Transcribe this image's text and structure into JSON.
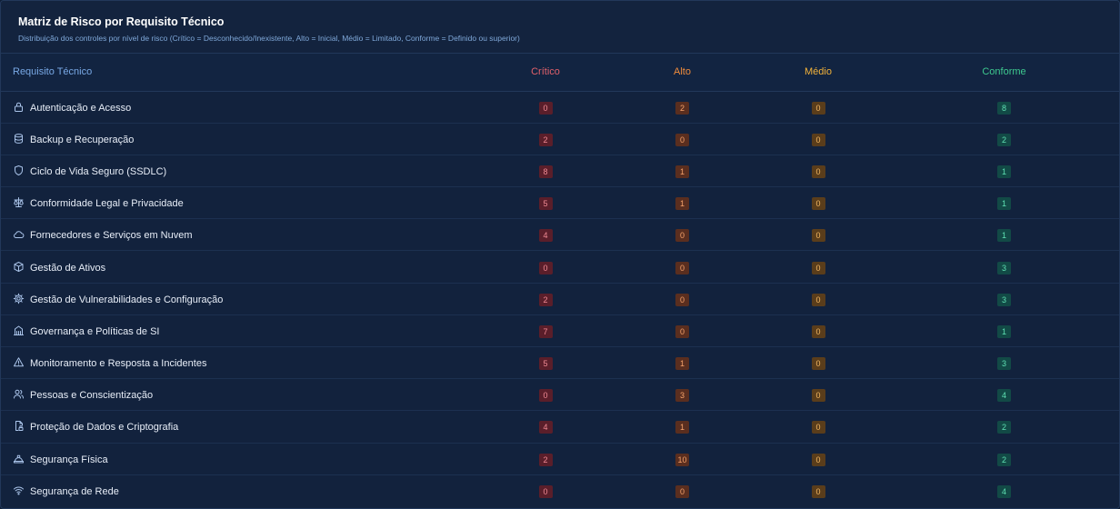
{
  "header": {
    "title": "Matriz de Risco por Requisito Técnico",
    "subtitle": "Distribuição dos controles por nível de risco (Crítico = Desconhecido/Inexistente, Alto = Inicial, Médio = Limitado, Conforme = Definido ou superior)"
  },
  "columns": {
    "requisito": "Requisito Técnico",
    "critico": "Crítico",
    "alto": "Alto",
    "medio": "Médio",
    "conforme": "Conforme"
  },
  "colors": {
    "critico": "#e0606a",
    "alto": "#f08c3c",
    "medio": "#f2b23a",
    "conforme": "#3ec98f"
  },
  "rows": [
    {
      "label": "Autenticação e Acesso",
      "icon": "lock-icon",
      "critico": "0",
      "alto": "2",
      "medio": "0",
      "conforme": "8"
    },
    {
      "label": "Backup e Recuperação",
      "icon": "database-icon",
      "critico": "2",
      "alto": "0",
      "medio": "0",
      "conforme": "2"
    },
    {
      "label": "Ciclo de Vida Seguro (SSDLC)",
      "icon": "shield-icon",
      "critico": "8",
      "alto": "1",
      "medio": "0",
      "conforme": "1"
    },
    {
      "label": "Conformidade Legal e Privacidade",
      "icon": "scale-icon",
      "critico": "5",
      "alto": "1",
      "medio": "0",
      "conforme": "1"
    },
    {
      "label": "Fornecedores e Serviços em Nuvem",
      "icon": "cloud-icon",
      "critico": "4",
      "alto": "0",
      "medio": "0",
      "conforme": "1"
    },
    {
      "label": "Gestão de Ativos",
      "icon": "box-icon",
      "critico": "0",
      "alto": "0",
      "medio": "0",
      "conforme": "3"
    },
    {
      "label": "Gestão de Vulnerabilidades e Configuração",
      "icon": "gear-icon",
      "critico": "2",
      "alto": "0",
      "medio": "0",
      "conforme": "3"
    },
    {
      "label": "Governança e Políticas de SI",
      "icon": "building-icon",
      "critico": "7",
      "alto": "0",
      "medio": "0",
      "conforme": "1"
    },
    {
      "label": "Monitoramento e Resposta a Incidentes",
      "icon": "warning-icon",
      "critico": "5",
      "alto": "1",
      "medio": "0",
      "conforme": "3"
    },
    {
      "label": "Pessoas e Conscientização",
      "icon": "users-icon",
      "critico": "0",
      "alto": "3",
      "medio": "0",
      "conforme": "4"
    },
    {
      "label": "Proteção de Dados e Criptografia",
      "icon": "file-lock-icon",
      "critico": "4",
      "alto": "1",
      "medio": "0",
      "conforme": "2"
    },
    {
      "label": "Segurança Física",
      "icon": "hardhat-icon",
      "critico": "2",
      "alto": "10",
      "medio": "0",
      "conforme": "2"
    },
    {
      "label": "Segurança de Rede",
      "icon": "wifi-icon",
      "critico": "0",
      "alto": "0",
      "medio": "0",
      "conforme": "4"
    }
  ]
}
